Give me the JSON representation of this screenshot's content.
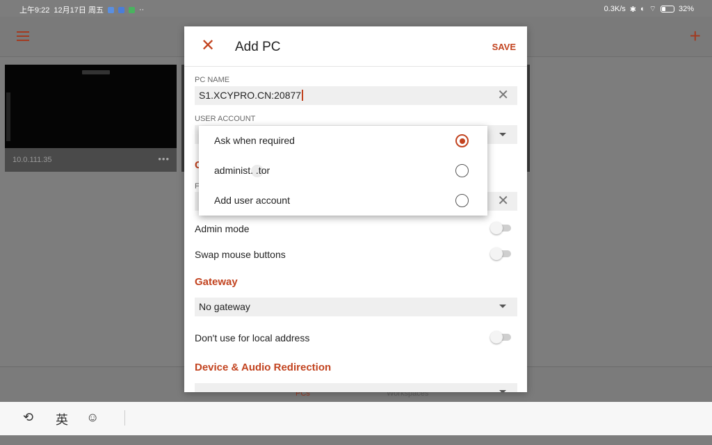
{
  "status_bar": {
    "time": "上午9:22",
    "date": "12月17日 周五",
    "notif_icons": [
      "chat-app-icon",
      "video-app-icon",
      "wechat-icon"
    ],
    "more": "··",
    "speed": "0.3K/s",
    "battery": "32%"
  },
  "background": {
    "tile_label": "10.0.111.35",
    "tile_more": "•••",
    "tab_pcs": "PCs",
    "tab_workspaces": "Workspaces"
  },
  "keyboard": {
    "lang": "英"
  },
  "dialog": {
    "title": "Add PC",
    "save": "SAVE",
    "pc_name_label": "PC NAME",
    "pc_name_value": "S1.XCYPRO.CN:20877",
    "user_account_label": "USER ACCOUNT",
    "admin_mode": "Admin mode",
    "swap_mouse": "Swap mouse buttons",
    "gateway_section": "Gateway",
    "gateway_value": "No gateway",
    "dont_use_local": "Don't use for local address",
    "device_audio_section": "Device & Audio Redirection",
    "partial_section_letter": "G",
    "partial_field_letter": "F"
  },
  "popup": {
    "options": [
      {
        "label": "Ask when required",
        "selected": true
      },
      {
        "label": "administ. .tor",
        "selected": false
      },
      {
        "label": "Add user account",
        "selected": false
      }
    ]
  },
  "colors": {
    "accent": "#c2431f",
    "scrim": "#7d7d7d"
  }
}
